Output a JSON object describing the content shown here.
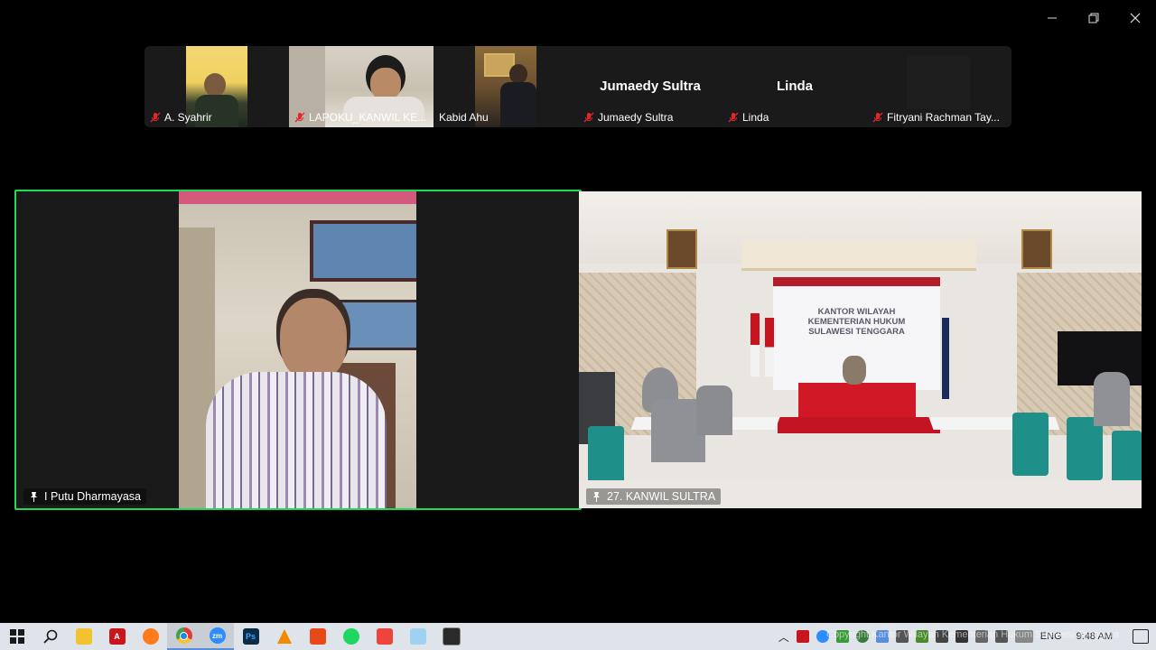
{
  "window": {
    "minimize_label": "minimize",
    "restore_label": "restore",
    "close_label": "close"
  },
  "gallery": [
    {
      "name": "A.  Syahrir",
      "muted": true,
      "has_video": true
    },
    {
      "name": "LAPOKU_KANWIL KE...",
      "muted": true,
      "has_video": true
    },
    {
      "name": "Kabid Ahu",
      "muted": false,
      "has_video": true
    },
    {
      "name": "Jumaedy Sultra",
      "display_name": "Jumaedy Sultra",
      "muted": true,
      "has_video": false
    },
    {
      "name": "Linda",
      "display_name": "Linda",
      "muted": true,
      "has_video": false
    },
    {
      "name": "Fitryani Rachman Tay...",
      "muted": true,
      "has_video": false
    }
  ],
  "main": {
    "left": {
      "name": "I Putu Dharmayasa",
      "active_speaker": true
    },
    "right": {
      "name": "27. KANWIL SULTRA",
      "banner": [
        "KANTOR WILAYAH",
        "KEMENTERIAN HUKUM",
        "SULAWESI TENGGARA"
      ]
    }
  },
  "colors": {
    "active_speaker": "#23d959",
    "muted_icon": "#e02828",
    "taskbar_bg": "#dfe3ea"
  },
  "taskbar": {
    "apps": [
      "start",
      "search",
      "file-explorer",
      "acrobat",
      "firefox",
      "chrome",
      "zoom",
      "photoshop",
      "vlc",
      "office",
      "spotify",
      "anydesk",
      "notepad",
      "vmware"
    ],
    "language": "ENG",
    "time": "9:48 AM"
  },
  "watermark": "Copyright Kantor Wilayah Kementerian Hukum Sulawesi Tenggara"
}
